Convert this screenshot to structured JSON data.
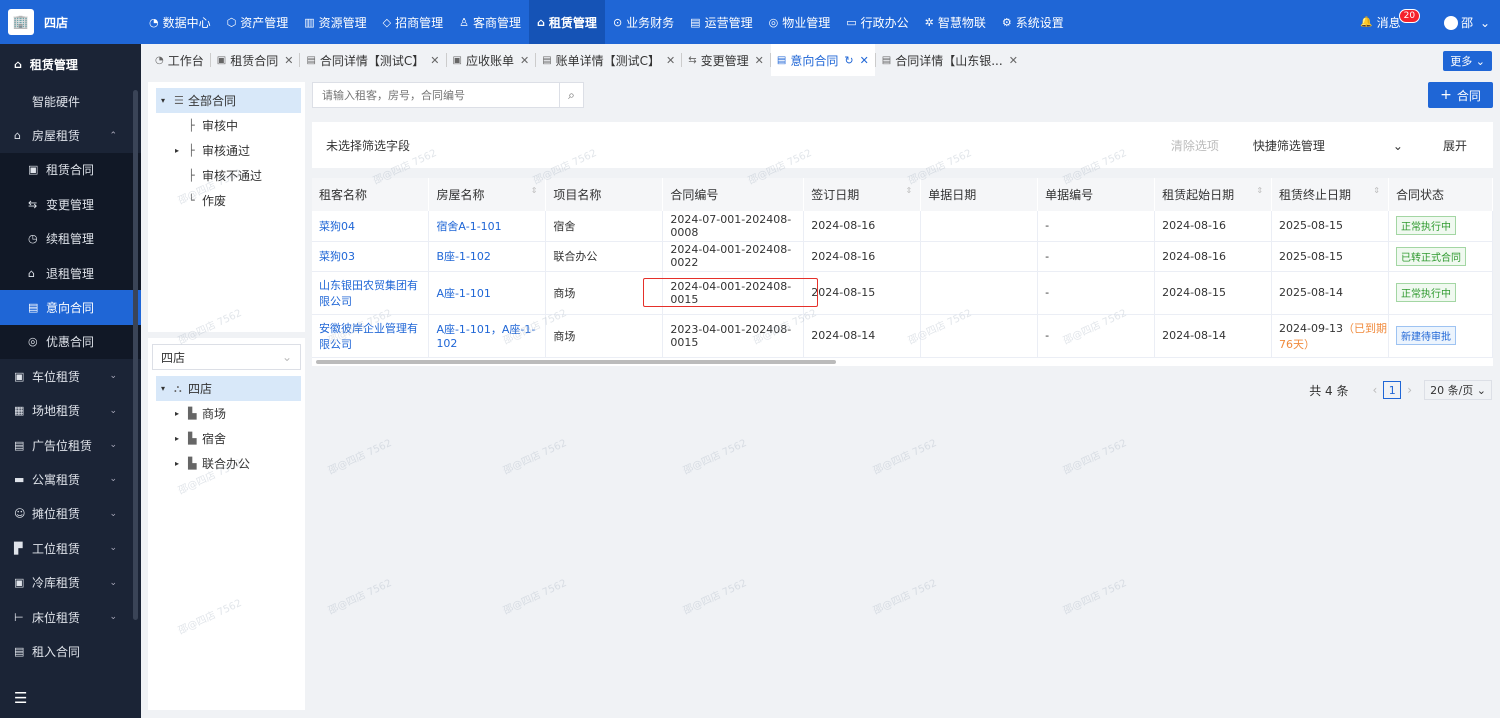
{
  "app": {
    "name": "四店",
    "logo_glyph": "🏢"
  },
  "topnav": [
    {
      "icon": "◔",
      "label": "数据中心"
    },
    {
      "icon": "⬡",
      "label": "资产管理"
    },
    {
      "icon": "▥",
      "label": "资源管理"
    },
    {
      "icon": "◇",
      "label": "招商管理"
    },
    {
      "icon": "♙",
      "label": "客商管理"
    },
    {
      "icon": "⌂",
      "label": "租赁管理",
      "active": true
    },
    {
      "icon": "⊙",
      "label": "业务财务"
    },
    {
      "icon": "▤",
      "label": "运营管理"
    },
    {
      "icon": "◎",
      "label": "物业管理"
    },
    {
      "icon": "▭",
      "label": "行政办公"
    },
    {
      "icon": "✲",
      "label": "智慧物联"
    },
    {
      "icon": "⚙",
      "label": "系统设置"
    }
  ],
  "topright": {
    "bell": "🔔",
    "messages_label": "消息",
    "messages_count": "20",
    "user": "邵",
    "chevron": "⌄"
  },
  "sidebar": {
    "head_icon": "⌂",
    "head": "租赁管理",
    "items": [
      {
        "icon": "",
        "label": "智能硬件",
        "type": "plain"
      },
      {
        "icon": "⌂",
        "label": "房屋租赁",
        "arrow": "⌃",
        "type": "group"
      },
      {
        "icon": "▣",
        "label": "租赁合同",
        "type": "sub"
      },
      {
        "icon": "⇆",
        "label": "变更管理",
        "type": "sub"
      },
      {
        "icon": "◷",
        "label": "续租管理",
        "type": "sub"
      },
      {
        "icon": "⌂",
        "label": "退租管理",
        "type": "sub"
      },
      {
        "icon": "▤",
        "label": "意向合同",
        "type": "sub",
        "active": true
      },
      {
        "icon": "◎",
        "label": "优惠合同",
        "type": "sub"
      },
      {
        "icon": "▣",
        "label": "车位租赁",
        "arrow": "⌄",
        "type": "group"
      },
      {
        "icon": "▦",
        "label": "场地租赁",
        "arrow": "⌄",
        "type": "group"
      },
      {
        "icon": "▤",
        "label": "广告位租赁",
        "arrow": "⌄",
        "type": "group"
      },
      {
        "icon": "▬",
        "label": "公寓租赁",
        "arrow": "⌄",
        "type": "group"
      },
      {
        "icon": "☺",
        "label": "摊位租赁",
        "arrow": "⌄",
        "type": "group"
      },
      {
        "icon": "▛",
        "label": "工位租赁",
        "arrow": "⌄",
        "type": "group"
      },
      {
        "icon": "▣",
        "label": "冷库租赁",
        "arrow": "⌄",
        "type": "group"
      },
      {
        "icon": "⊢",
        "label": "床位租赁",
        "arrow": "⌄",
        "type": "group"
      },
      {
        "icon": "▤",
        "label": "租入合同",
        "type": "group"
      }
    ],
    "footer_icon": "☰"
  },
  "tabs": [
    {
      "icon": "◔",
      "label": "工作台",
      "close": false
    },
    {
      "icon": "▣",
      "label": "租赁合同",
      "close": true
    },
    {
      "icon": "▤",
      "label": "合同详情【测试C】",
      "close": true
    },
    {
      "icon": "▣",
      "label": "应收账单",
      "close": true
    },
    {
      "icon": "▤",
      "label": "账单详情【测试C】",
      "close": true
    },
    {
      "icon": "⇆",
      "label": "变更管理",
      "close": true
    },
    {
      "icon": "▤",
      "label": "意向合同",
      "close": true,
      "active": true,
      "refresh": "↻"
    },
    {
      "icon": "▤",
      "label": "合同详情【山东银...",
      "close": true
    }
  ],
  "tab_close_glyph": "✕",
  "more_label": "更多 ⌄",
  "status_tree": {
    "root": "全部合同",
    "root_icon": "☰",
    "expand_glyph": "▾",
    "collapsed_glyph": "▸",
    "children": [
      {
        "label": "审核中",
        "line": "├"
      },
      {
        "label": "审核通过",
        "line": "├",
        "expandable": true
      },
      {
        "label": "审核不通过",
        "line": "├"
      },
      {
        "label": "作废",
        "line": "└"
      }
    ]
  },
  "store_select": {
    "value": "四店",
    "chevron": "⌄"
  },
  "store_tree": {
    "root": "四店",
    "root_icon": "⛬",
    "children": [
      {
        "icon": "▙",
        "label": "商场"
      },
      {
        "icon": "▙",
        "label": "宿舍"
      },
      {
        "icon": "▙",
        "label": "联合办公"
      }
    ]
  },
  "search": {
    "placeholder": "请输入租客，房号，合同编号",
    "icon": "⌕"
  },
  "add_button": {
    "icon": "+",
    "label": "合同"
  },
  "filter": {
    "label": "未选择筛选字段",
    "clear": "清除选项",
    "manage": "快捷筛选管理",
    "expand_icon": "⌄",
    "expand": "展开"
  },
  "table": {
    "sort_glyph": "⇕",
    "columns": [
      {
        "label": "租客名称",
        "sortable": false
      },
      {
        "label": "房屋名称",
        "sortable": true
      },
      {
        "label": "项目名称",
        "sortable": false
      },
      {
        "label": "合同编号",
        "sortable": false
      },
      {
        "label": "签订日期",
        "sortable": true
      },
      {
        "label": "单据日期",
        "sortable": false
      },
      {
        "label": "单据编号",
        "sortable": false
      },
      {
        "label": "租赁起始日期",
        "sortable": true
      },
      {
        "label": "租赁终止日期",
        "sortable": true
      },
      {
        "label": "合同状态",
        "sortable": false
      }
    ],
    "rows": [
      {
        "tenant": "菜狗04",
        "room": "宿舍A-1-101",
        "project": "宿舍",
        "contract_no": "2024-07-001-202408-0008",
        "sign_date": "2024-08-16",
        "doc_date": "",
        "doc_no": "-",
        "start": "2024-08-16",
        "end": "2025-08-15",
        "overdue": "",
        "status": "正常执行中",
        "status_color": "green"
      },
      {
        "tenant": "菜狗03",
        "room": "B座-1-102",
        "project": "联合办公",
        "contract_no": "2024-04-001-202408-0022",
        "sign_date": "2024-08-16",
        "doc_date": "",
        "doc_no": "-",
        "start": "2024-08-16",
        "end": "2025-08-15",
        "overdue": "",
        "status": "已转正式合同",
        "status_color": "green"
      },
      {
        "tenant": "山东银田农贸集团有限公司",
        "room": "A座-1-101",
        "project": "商场",
        "contract_no": "2024-04-001-202408-0015",
        "sign_date": "2024-08-15",
        "doc_date": "",
        "doc_no": "-",
        "start": "2024-08-15",
        "end": "2025-08-14",
        "overdue": "",
        "status": "正常执行中",
        "status_color": "green"
      },
      {
        "tenant": "安徽彼岸企业管理有限公司",
        "room": "A座-1-101，A座-1-102",
        "project": "商场",
        "contract_no": "2023-04-001-202408-0015",
        "sign_date": "2024-08-14",
        "doc_date": "",
        "doc_no": "-",
        "start": "2024-08-14",
        "end": "2024-09-13",
        "overdue": "（已到期 76天）",
        "status": "新建待审批",
        "status_color": "blue"
      }
    ]
  },
  "pager": {
    "total": "共 4 条",
    "prev": "‹",
    "page": "1",
    "next": "›",
    "size": "20 条/页 ⌄"
  },
  "watermark": "邵@四店 7562"
}
